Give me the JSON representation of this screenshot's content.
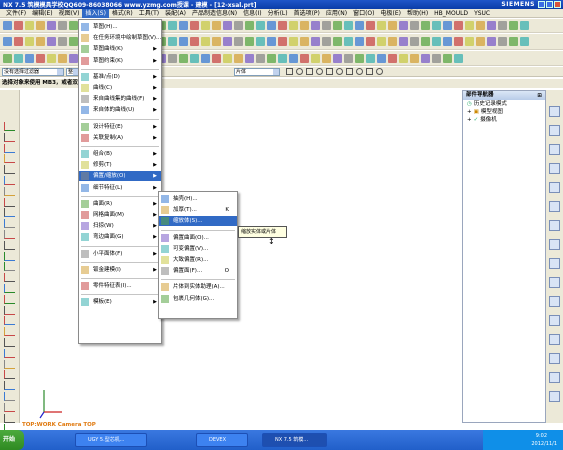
{
  "window": {
    "title": "NX 7.5 筑模模具学校QQ609-86038066 www.yzmg.com授课 - 建模 - [12-xsal.prt]",
    "brand": "SIEMENS"
  },
  "menubar": [
    "文件(F)",
    "编辑(E)",
    "视图(V)",
    "插入(S)",
    "格式(R)",
    "工具(T)",
    "装配(A)",
    "产品制造信息(N)",
    "信息(I)",
    "分析(L)",
    "首选项(P)",
    "应用(N)",
    "窗口(O)",
    "电极(E)",
    "帮助(H)",
    "HB_MOULD",
    "YSUC"
  ],
  "filterbar": {
    "filter_label": "没有选择过滤器",
    "filter2": "整",
    "snap_combo": "片体"
  },
  "status_prompt": "选择对象来使用 MB3，或者双击某一对象",
  "insert_menu": [
    {
      "label": "草图(H)...",
      "arrow": false
    },
    {
      "label": "在任务环境中绘制草图(V)...",
      "arrow": false
    },
    {
      "label": "草图曲线(K)",
      "arrow": true
    },
    {
      "label": "草图约束(K)",
      "arrow": true
    },
    {
      "sep": true
    },
    {
      "label": "基准/点(D)",
      "arrow": true
    },
    {
      "label": "曲线(C)",
      "arrow": true
    },
    {
      "label": "来自曲线集的曲线(F)",
      "arrow": true
    },
    {
      "label": "来自体的曲线(U)",
      "arrow": true
    },
    {
      "sep": true
    },
    {
      "label": "设计特征(E)",
      "arrow": true
    },
    {
      "label": "关联复制(A)",
      "arrow": true
    },
    {
      "sep": true
    },
    {
      "label": "组合(B)",
      "arrow": true
    },
    {
      "label": "修剪(T)",
      "arrow": true
    },
    {
      "label": "偏置/缩放(O)",
      "arrow": true,
      "highlight": true
    },
    {
      "label": "细节特征(L)",
      "arrow": true
    },
    {
      "sep": true
    },
    {
      "label": "曲面(R)",
      "arrow": true
    },
    {
      "label": "网格曲面(M)",
      "arrow": true
    },
    {
      "label": "扫掠(W)",
      "arrow": true
    },
    {
      "label": "弯边曲面(G)",
      "arrow": true
    },
    {
      "sep": true
    },
    {
      "label": "小平面体(F)",
      "arrow": true
    },
    {
      "sep": true
    },
    {
      "label": "钣金建模(I)",
      "arrow": true
    },
    {
      "sep": true
    },
    {
      "label": "零件特征表(I)...",
      "arrow": false
    },
    {
      "sep": true
    },
    {
      "label": "模板(E)",
      "arrow": true
    }
  ],
  "offset_submenu": [
    {
      "label": "抽壳(H)...",
      "key": ""
    },
    {
      "label": "加厚(T)...",
      "key": "K"
    },
    {
      "label": "缩放体(S)...",
      "key": "",
      "highlight": true
    },
    {
      "sep": true
    },
    {
      "label": "偏置曲面(O)...",
      "key": ""
    },
    {
      "label": "可变偏置(V)...",
      "key": ""
    },
    {
      "label": "大致偏置(R)...",
      "key": ""
    },
    {
      "label": "偏置面(F)...",
      "key": "O"
    },
    {
      "sep": true
    },
    {
      "label": "片体到实体助理(A)...",
      "key": ""
    },
    {
      "label": "包裹几何体(G)...",
      "key": ""
    }
  ],
  "tooltip": "缩放实体或片体",
  "navigator": {
    "title": "部件导航器",
    "rows": [
      "历史记录模式",
      "模型视图",
      "摄像机"
    ]
  },
  "view_label": "TOP:WORK Camera TOP",
  "taskbar": {
    "start": "开始",
    "items": [
      "UGY 5.型芯机...",
      "DEVEX",
      "NX 7.5 筑模..."
    ],
    "clock": "9:02",
    "date": "2012/11/1"
  },
  "colors": {
    "accent": "#316ac5",
    "title": "#0b3da8",
    "view_label": "#e07a10"
  }
}
